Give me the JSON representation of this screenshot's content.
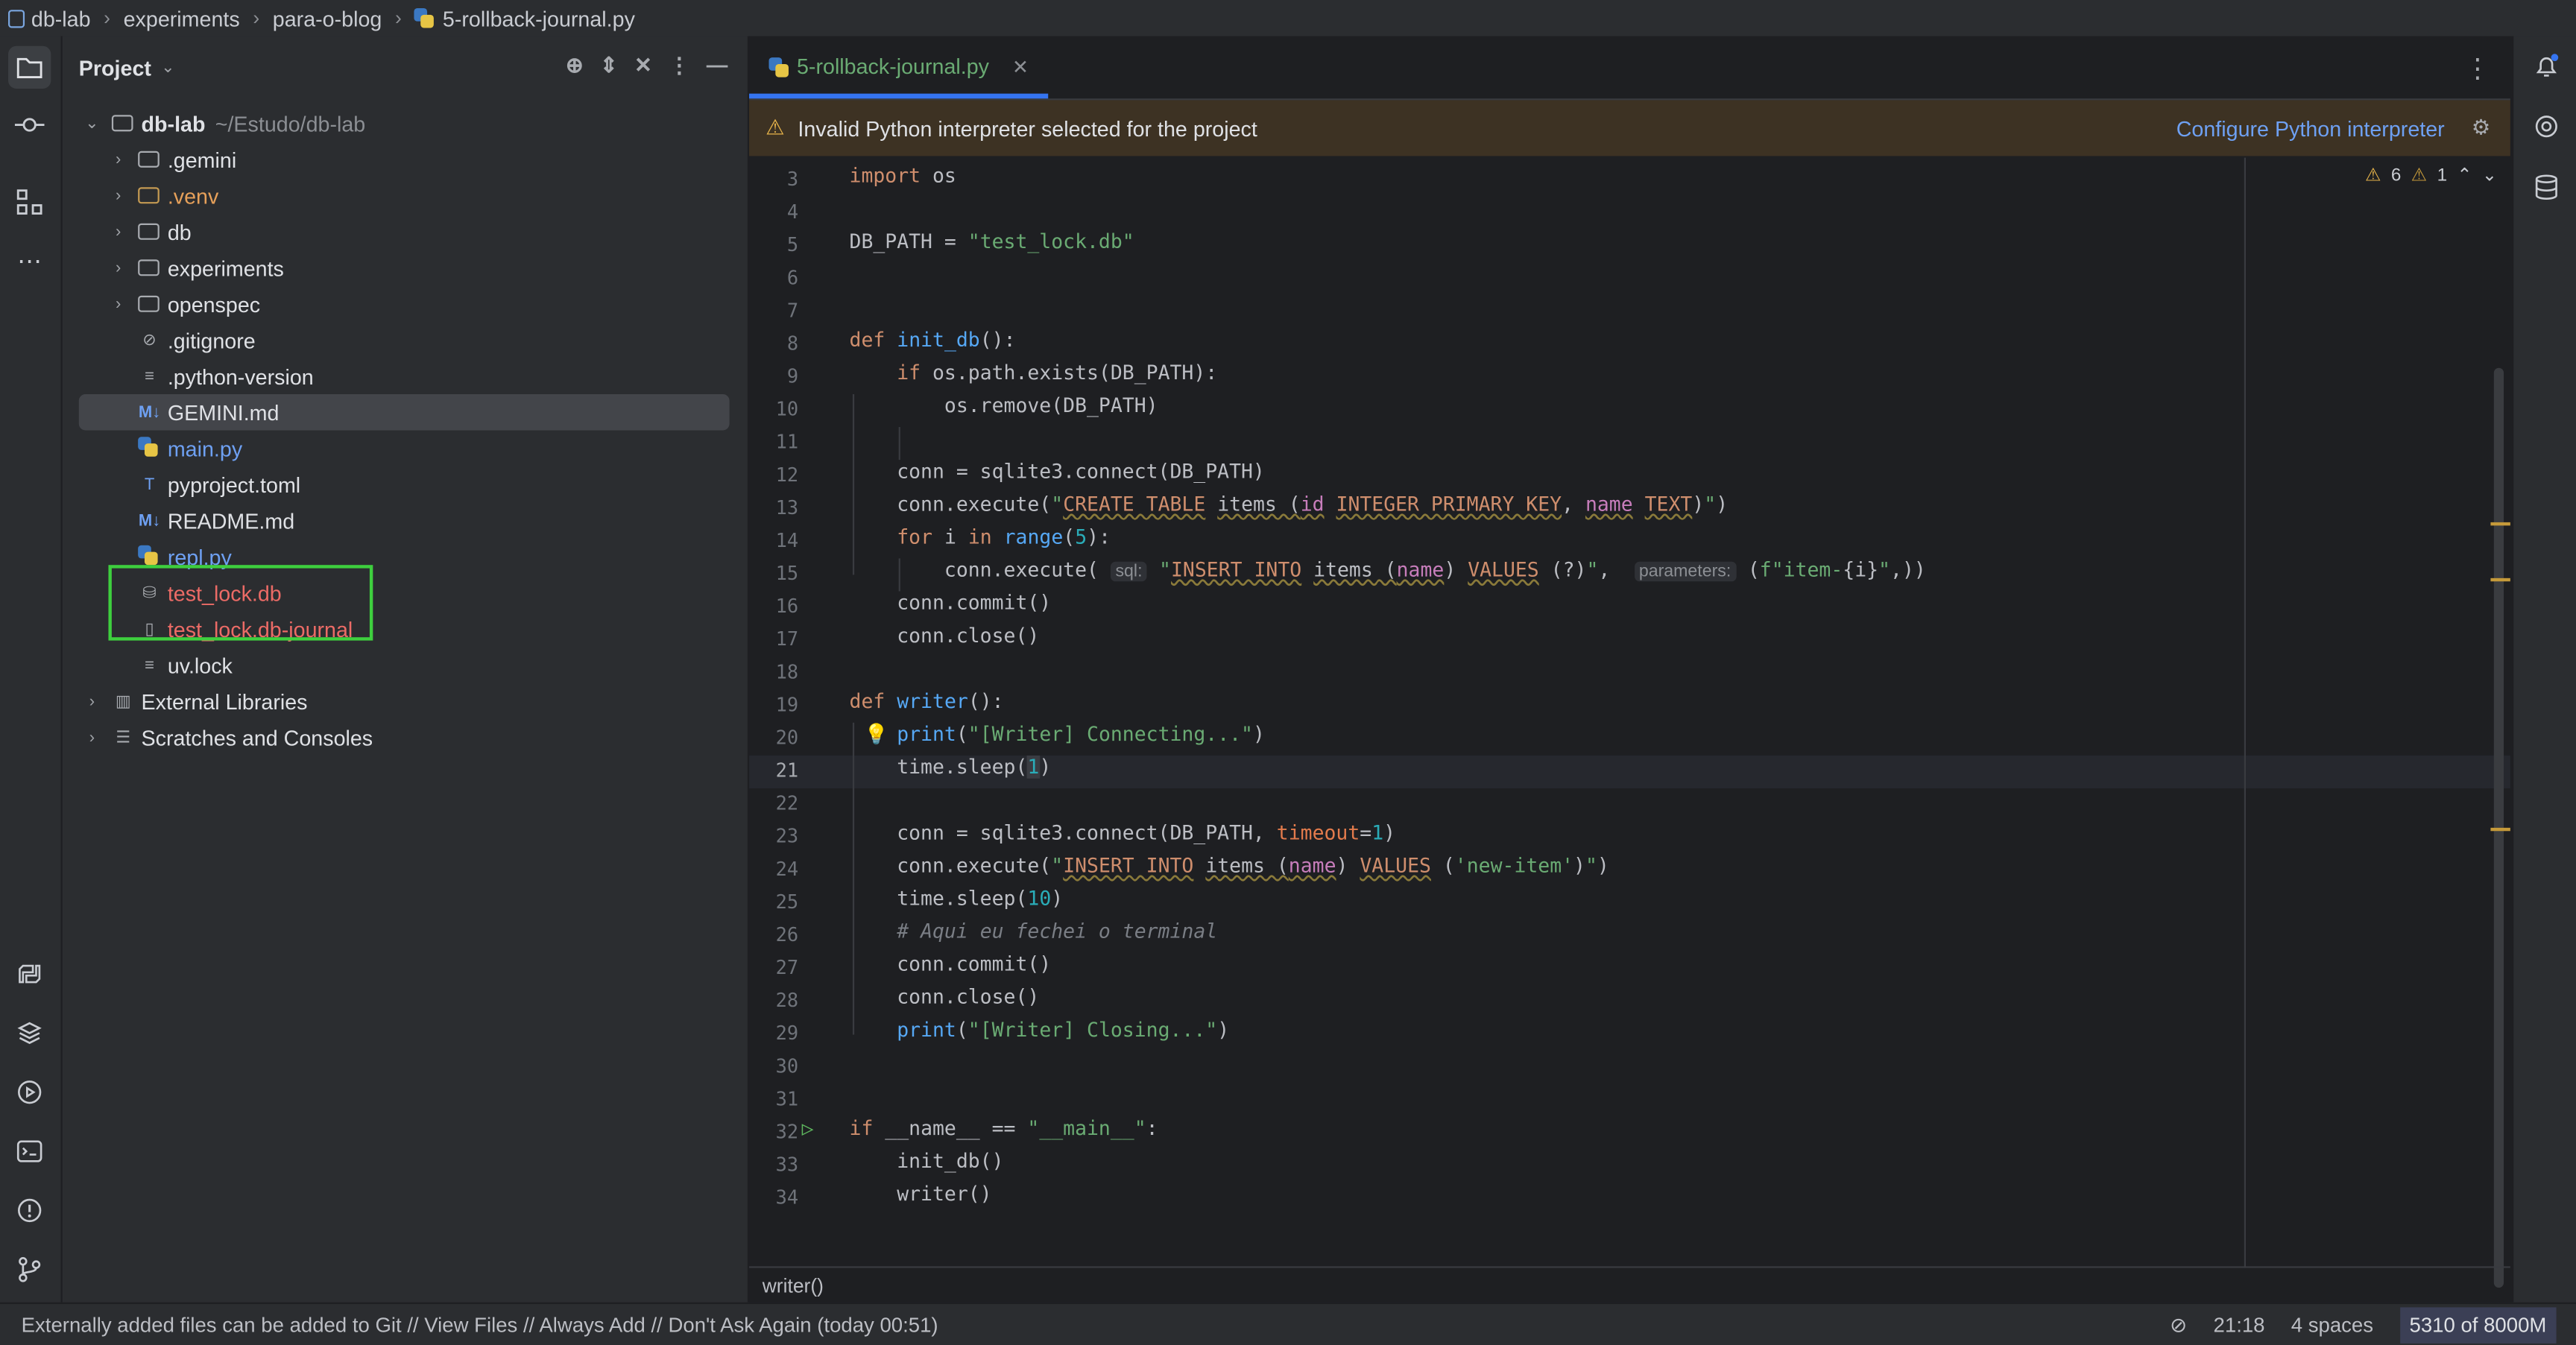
{
  "breadcrumb": [
    "db-lab",
    "experiments",
    "para-o-blog",
    "5-rollback-journal.py"
  ],
  "project_panel": {
    "title": "Project",
    "root": {
      "name": "db-lab",
      "path": "~/Estudo/db-lab"
    },
    "items": [
      {
        "label": ".gemini",
        "type": "folder"
      },
      {
        "label": ".venv",
        "type": "folder"
      },
      {
        "label": "db",
        "type": "folder"
      },
      {
        "label": "experiments",
        "type": "folder"
      },
      {
        "label": "openspec",
        "type": "folder"
      },
      {
        "label": ".gitignore",
        "type": "file"
      },
      {
        "label": ".python-version",
        "type": "file"
      },
      {
        "label": "GEMINI.md",
        "type": "file"
      },
      {
        "label": "main.py",
        "type": "file"
      },
      {
        "label": "pyproject.toml",
        "type": "file"
      },
      {
        "label": "README.md",
        "type": "file"
      },
      {
        "label": "repl.py",
        "type": "file"
      },
      {
        "label": "test_lock.db",
        "type": "file"
      },
      {
        "label": "test_lock.db-journal",
        "type": "file"
      },
      {
        "label": "uv.lock",
        "type": "file"
      },
      {
        "label": "External Libraries",
        "type": "node"
      },
      {
        "label": "Scratches and Consoles",
        "type": "node"
      }
    ]
  },
  "editor": {
    "tab_label": "5-rollback-journal.py",
    "banner": {
      "message": "Invalid Python interpreter selected for the project",
      "action": "Configure Python interpreter"
    },
    "inspections": {
      "warnings": "6",
      "weak_warnings": "1"
    },
    "breadcrumb": "writer()",
    "line_numbers": [
      "3",
      "4",
      "5",
      "6",
      "7",
      "8",
      "9",
      "10",
      "11",
      "12",
      "13",
      "14",
      "15",
      "16",
      "17",
      "18",
      "19",
      "20",
      "21",
      "22",
      "23",
      "24",
      "25",
      "26",
      "27",
      "28",
      "29",
      "30",
      "31",
      "32",
      "33",
      "34"
    ],
    "current_line": "21",
    "hints": {
      "sql": "sql:",
      "parameters": "parameters:"
    }
  },
  "status_bar": {
    "message": "Externally added files can be added to Git // View Files // Always Add // Don't Ask Again (today 00:51)",
    "position": "21:18",
    "indent": "4 spaces",
    "memory": "5310 of 8000M"
  }
}
